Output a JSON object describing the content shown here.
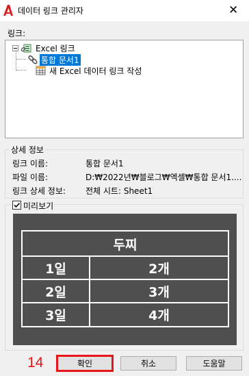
{
  "window": {
    "title": "데이터 링크 관리자"
  },
  "links_label": "링크:",
  "tree": {
    "root_label": "Excel 링크",
    "children": [
      {
        "label": "통합 문서1",
        "selected": true,
        "icon": "link-icon"
      },
      {
        "label": "새 Excel 데이터 링크 작성",
        "selected": false,
        "icon": "new-table-icon"
      }
    ]
  },
  "details": {
    "caption": "상세 정보",
    "rows": [
      {
        "key": "링크 이름:",
        "value": "통합 문서1"
      },
      {
        "key": "파일 이름:",
        "value": "D:₩2022년₩블로그₩엑셀₩통합 문서1...."
      },
      {
        "key": "링크 상세 정보:",
        "value": "전체 시트: Sheet1"
      }
    ]
  },
  "preview": {
    "checkbox_label": "미리보기",
    "checked": true,
    "table": {
      "header": "두찌",
      "rows": [
        [
          "1일",
          "2개"
        ],
        [
          "2일",
          "3개"
        ],
        [
          "3일",
          "4개"
        ]
      ]
    }
  },
  "buttons": {
    "ok": "확인",
    "cancel": "취소",
    "help": "도움말"
  },
  "annotation": {
    "number": "14",
    "color": "#e8141a"
  },
  "colors": {
    "selection": "#0078d7",
    "preview_bg": "#4f4f4f",
    "app_icon": "#e01b1b"
  }
}
